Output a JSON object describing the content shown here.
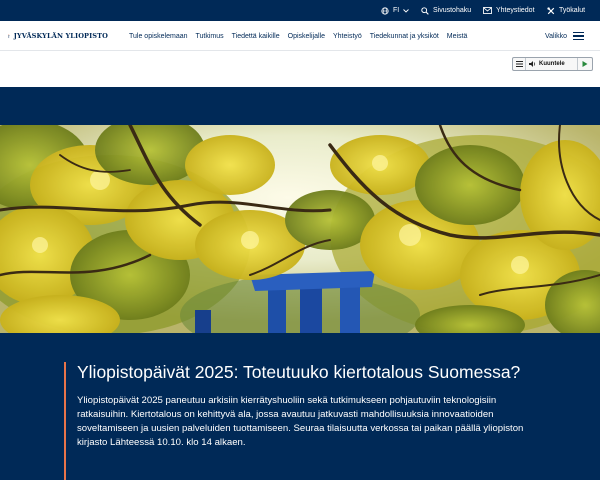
{
  "utility_bar": {
    "language": "FI",
    "search_label": "Sivustohaku",
    "contact_label": "Yhteystiedot",
    "tools_label": "Työkalut"
  },
  "header": {
    "logo_text": "JYVÄSKYLÄN YLIOPISTO",
    "nav_items": [
      "Tule opiskelemaan",
      "Tutkimus",
      "Tiedettä kaikille",
      "Opiskelijalle",
      "Yhteistyö",
      "Tiedekunnat ja yksiköt",
      "Meistä"
    ],
    "menu_label": "Valikko"
  },
  "listen_widget": {
    "label": "Kuuntele"
  },
  "article": {
    "title": "Yliopistopäivät 2025: Toteutuuko kiertotalous Suomessa?",
    "body": "Yliopistopäivät 2025 paneutuu arkisiin kierrätyshuoliin sekä tutkimukseen pohjautuviin teknologisiin ratkaisuihin. Kiertotalous on kehittyvä ala, jossa avautuu jatkuvasti mahdollisuuksia innovaatioiden soveltamiseen ja uusien palveluiden tuottamiseen. Seuraa tilaisuutta verkossa tai paikan päällä yliopiston kirjasto Lähteessä 10.10. klo 14 alkaen."
  },
  "colors": {
    "brand_navy": "#002957",
    "accent_orange": "#e8744a"
  },
  "icons": {
    "language": "globe-icon",
    "search": "search-icon",
    "contact": "mail-icon",
    "tools": "tools-icon",
    "menu": "hamburger-icon"
  }
}
